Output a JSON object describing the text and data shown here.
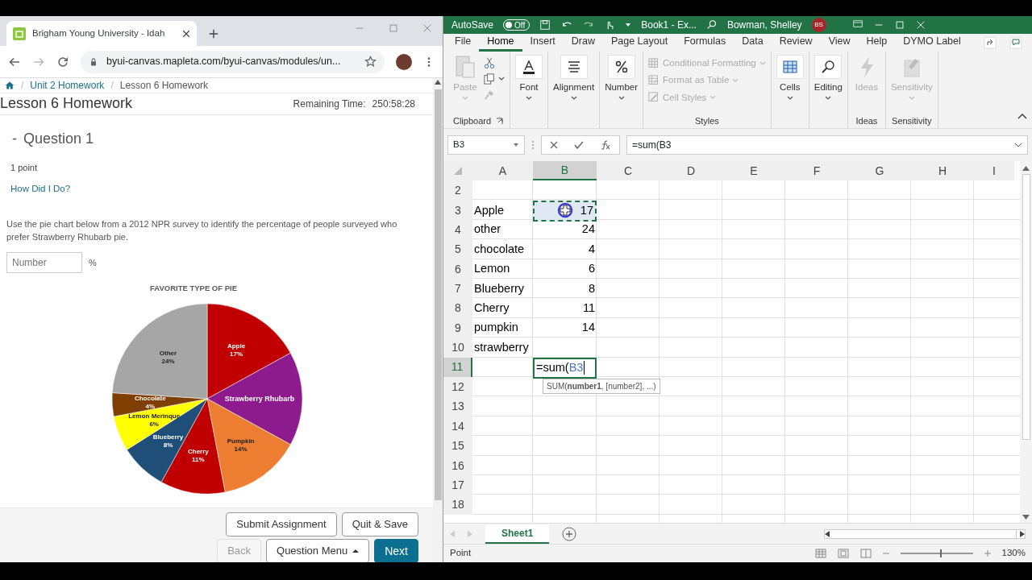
{
  "browser": {
    "tab_title": "Brigham Young University - Idah",
    "url": "byui-canvas.mapleta.com/byui-canvas/modules/un..."
  },
  "page": {
    "breadcrumbs": [
      {
        "separator": "/",
        "label": "Unit 2 Homework",
        "link": true
      },
      {
        "separator": "/",
        "label": "Lesson 6 Homework",
        "link": false
      }
    ],
    "title": "Lesson 6 Homework",
    "remaining_label": "Remaining Time:",
    "remaining_time": "250:58:28",
    "question": {
      "marker": "-",
      "title": "Question 1",
      "points": "1 point",
      "feedback_link": "How Did I Do?",
      "text": "Use the pie chart below from a 2012 NPR survey to identify the percentage of people surveyed who prefer Strawberry Rhubarb pie.",
      "answer": {
        "placeholder": "Number",
        "unit": "%"
      },
      "chart_data": {
        "type": "pie",
        "title": "FAVORITE TYPE OF PIE",
        "categories": [
          "Apple",
          "Strawberry Rhubarb",
          "Pumpkin",
          "Cherry",
          "Blueberry",
          "Lemon Merinque",
          "Chocolate",
          "Other"
        ],
        "values": [
          17,
          16,
          14,
          11,
          8,
          6,
          4,
          24
        ],
        "colors": [
          "#c00000",
          "#8e1b8e",
          "#ed7d31",
          "#c00000",
          "#1f4e79",
          "#ffff00",
          "#7f3f00",
          "#a6a6a6"
        ],
        "value_labels": [
          "17%",
          null,
          "14%",
          "11%",
          "8%",
          "6%",
          "4%",
          "24%"
        ]
      }
    },
    "footer": [
      [
        {
          "label": "Submit Assignment",
          "kind": "default",
          "disabled": false
        },
        {
          "label": "Quit & Save",
          "kind": "default",
          "disabled": false
        }
      ],
      [
        {
          "label": "Back",
          "kind": "default",
          "disabled": true
        },
        {
          "label": "Question Menu",
          "kind": "menu",
          "disabled": false
        },
        {
          "label": "Next",
          "kind": "primary",
          "disabled": false
        }
      ]
    ]
  },
  "excel": {
    "title_bar": {
      "autosave_label": "AutoSave",
      "autosave_on": false,
      "autosave_state": "Off",
      "document": "Book1 - Ex...",
      "user": "Bowman, Shelley",
      "initials": "BS"
    },
    "tabs": [
      {
        "label": "File",
        "selected": false
      },
      {
        "label": "Home",
        "selected": true
      },
      {
        "label": "Insert",
        "selected": false
      },
      {
        "label": "Draw",
        "selected": false
      },
      {
        "label": "Page Layout",
        "selected": false
      },
      {
        "label": "Formulas",
        "selected": false
      },
      {
        "label": "Data",
        "selected": false
      },
      {
        "label": "Review",
        "selected": false
      },
      {
        "label": "View",
        "selected": false
      },
      {
        "label": "Help",
        "selected": false
      },
      {
        "label": "DYMO Label",
        "selected": false
      }
    ],
    "ribbon": [
      {
        "label": "Clipboard",
        "items": [
          {
            "kind": "large",
            "label": "Paste",
            "disabled": true,
            "dropdown": true
          },
          {
            "kind": "small",
            "disabled": false,
            "dropdown": false
          },
          {
            "kind": "small",
            "disabled": false,
            "dropdown": true
          },
          {
            "kind": "small",
            "disabled": true,
            "dropdown": false
          }
        ]
      },
      {
        "items": [
          {
            "kind": "large",
            "label": "Font",
            "disabled": false,
            "dropdown": true
          }
        ]
      },
      {
        "items": [
          {
            "kind": "large",
            "label": "Alignment",
            "disabled": false,
            "dropdown": true
          }
        ]
      },
      {
        "items": [
          {
            "kind": "large",
            "label": "Number",
            "disabled": false,
            "dropdown": true
          }
        ]
      },
      {
        "label": "Styles",
        "items": [
          {
            "kind": "row",
            "label": "Conditional Formatting",
            "disabled": true,
            "dropdown": true
          },
          {
            "kind": "row",
            "label": "Format as Table",
            "disabled": true,
            "dropdown": true
          },
          {
            "kind": "row",
            "label": "Cell Styles",
            "disabled": true,
            "dropdown": true
          }
        ]
      },
      {
        "items": [
          {
            "kind": "large",
            "label": "Cells",
            "disabled": false,
            "dropdown": true
          }
        ]
      },
      {
        "items": [
          {
            "kind": "large",
            "label": "Editing",
            "disabled": false,
            "dropdown": true
          }
        ]
      },
      {
        "label": "Ideas",
        "items": [
          {
            "kind": "large",
            "label": "Ideas",
            "disabled": true,
            "dropdown": false
          }
        ]
      },
      {
        "label": "Sensitivity",
        "items": [
          {
            "kind": "large",
            "label": "Sensitivity",
            "disabled": true,
            "dropdown": true
          }
        ]
      }
    ],
    "formula_bar": {
      "name_box": "B3",
      "formula": "=sum(B3"
    },
    "columns": [
      {
        "label": "A",
        "selected": false
      },
      {
        "label": "B",
        "selected": true
      },
      {
        "label": "C",
        "selected": false
      },
      {
        "label": "D",
        "selected": false
      },
      {
        "label": "E",
        "selected": false
      },
      {
        "label": "F",
        "selected": false
      },
      {
        "label": "G",
        "selected": false
      },
      {
        "label": "H",
        "selected": false
      },
      {
        "label": "I",
        "selected": false
      }
    ],
    "rows": [
      {
        "header": "2",
        "selected": false
      },
      {
        "header": "3",
        "selected": false,
        "cells": [
          {
            "kind": "text",
            "value": "Apple"
          },
          {
            "kind": "number",
            "value": "17",
            "referenced": true
          }
        ]
      },
      {
        "header": "4",
        "selected": false,
        "cells": [
          {
            "kind": "text",
            "value": "other"
          },
          {
            "kind": "number",
            "value": "24"
          }
        ]
      },
      {
        "header": "5",
        "selected": false,
        "cells": [
          {
            "kind": "text",
            "value": "chocolate"
          },
          {
            "kind": "number",
            "value": "4"
          }
        ]
      },
      {
        "header": "6",
        "selected": false,
        "cells": [
          {
            "kind": "text",
            "value": "Lemon"
          },
          {
            "kind": "number",
            "value": "6"
          }
        ]
      },
      {
        "header": "7",
        "selected": false,
        "cells": [
          {
            "kind": "text",
            "value": "Blueberry"
          },
          {
            "kind": "number",
            "value": "8"
          }
        ]
      },
      {
        "header": "8",
        "selected": false,
        "cells": [
          {
            "kind": "text",
            "value": "Cherry"
          },
          {
            "kind": "number",
            "value": "11"
          }
        ]
      },
      {
        "header": "9",
        "selected": false,
        "cells": [
          {
            "kind": "text",
            "value": "pumpkin"
          },
          {
            "kind": "number",
            "value": "14"
          }
        ]
      },
      {
        "header": "10",
        "selected": false,
        "cells": [
          {
            "kind": "text",
            "value": "strawberry"
          }
        ]
      },
      {
        "header": "11",
        "selected": true,
        "cells": [
          null,
          {
            "kind": "editing",
            "value": "=sum(",
            "reference": "B3"
          }
        ]
      },
      {
        "header": "12",
        "selected": false
      },
      {
        "header": "13",
        "selected": false
      },
      {
        "header": "14",
        "selected": false
      },
      {
        "header": "15",
        "selected": false
      },
      {
        "header": "16",
        "selected": false
      },
      {
        "header": "17",
        "selected": false
      },
      {
        "header": "18",
        "selected": false
      }
    ],
    "tooltip": "SUM(**number1**, [number2], ...)",
    "sheets": [
      {
        "label": "Sheet1",
        "selected": true
      }
    ],
    "status": "Point",
    "zoom_slider": {
      "level": 0.55
    },
    "zoom": "130%"
  }
}
